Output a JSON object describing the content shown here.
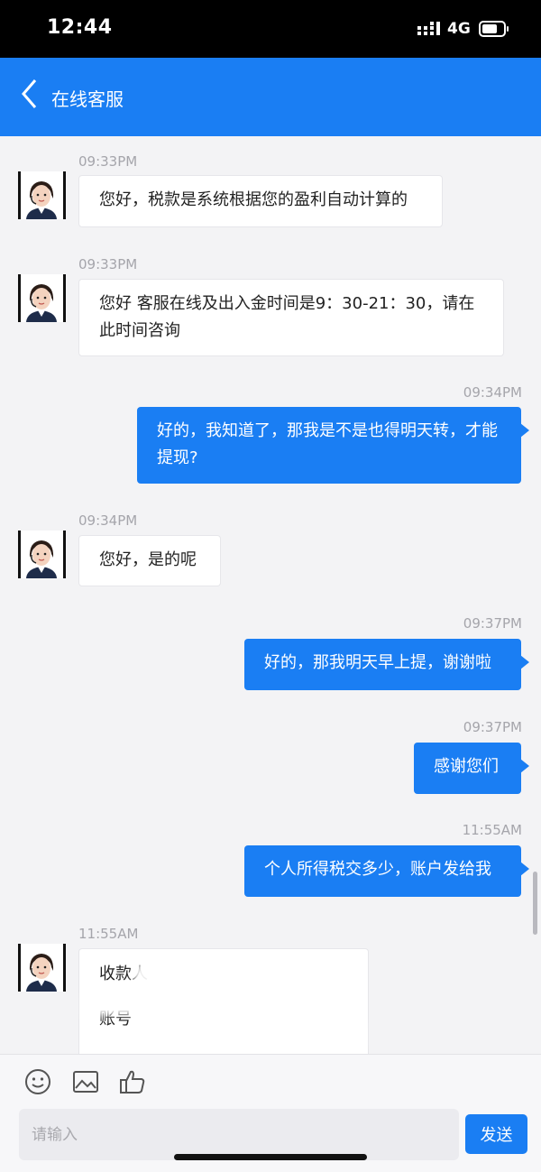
{
  "status_bar": {
    "time": "12:44",
    "network": "4G"
  },
  "nav": {
    "title": "在线客服",
    "back_icon": "chevron-left-icon"
  },
  "messages": [
    {
      "side": "in",
      "time": "09:33PM",
      "text": "您好，税款是系统根据您的盈利自动计算的"
    },
    {
      "side": "in",
      "time": "09:33PM",
      "text": "您好 客服在线及出入金时间是9：30-21：30，请在此时间咨询"
    },
    {
      "side": "out",
      "time": "09:34PM",
      "text": "好的，我知道了，那我是不是也得明天转，才能提现?"
    },
    {
      "side": "in",
      "time": "09:34PM",
      "text": "您好，是的呢"
    },
    {
      "side": "out",
      "time": "09:37PM",
      "text": "好的，那我明天早上提，谢谢啦"
    },
    {
      "side": "out",
      "time": "09:37PM",
      "text": "感谢您们"
    },
    {
      "side": "out",
      "time": "11:55AM",
      "text": "个人所得税交多少，账户发给我"
    },
    {
      "side": "in",
      "time": "11:55AM",
      "line1": "收款人",
      "line2": "账号"
    }
  ],
  "toolbar": {
    "icons": [
      "emoji-icon",
      "image-icon",
      "thumbs-up-icon"
    ],
    "input_placeholder": "请输入",
    "send_label": "发送"
  },
  "colors": {
    "accent": "#1a7ef3",
    "background": "#f3f3f5",
    "status_bar": "#000000"
  }
}
